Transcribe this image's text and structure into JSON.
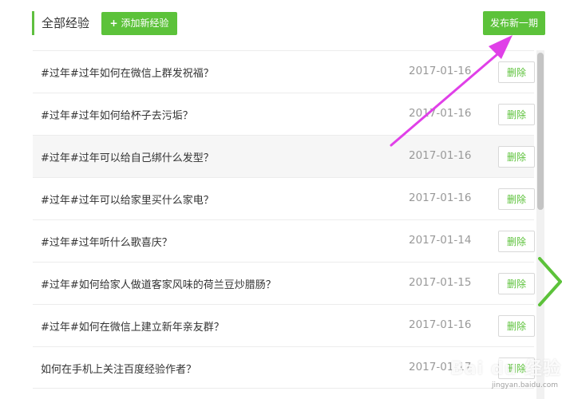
{
  "header": {
    "title": "全部经验",
    "add_button": "添加新经验",
    "add_icon": "+",
    "publish_button": "发布新一期"
  },
  "actions": {
    "delete_label": "删除"
  },
  "items": [
    {
      "name": "#过年#过年如何在微信上群发祝福？",
      "date": "2017-01-16"
    },
    {
      "name": "#过年#过年如何给杯子去污垢？",
      "date": "2017-01-16"
    },
    {
      "name": "#过年#过年可以给自己绑什么发型？",
      "date": "2017-01-16"
    },
    {
      "name": "#过年#过年可以给家里买什么家电？",
      "date": "2017-01-16"
    },
    {
      "name": "#过年#过年听什么歌喜庆？",
      "date": "2017-01-14"
    },
    {
      "name": "#过年#如何给家人做道客家风味的荷兰豆炒腊肠？",
      "date": "2017-01-15"
    },
    {
      "name": "#过年#如何在微信上建立新年亲友群？",
      "date": "2017-01-16"
    },
    {
      "name": "如何在手机上关注百度经验作者？",
      "date": "2017-01-17"
    }
  ],
  "watermark": {
    "text": "Bai du 经验",
    "sub": "jingyan.baidu.com"
  },
  "colors": {
    "accent": "#5cc23a",
    "arrow": "#e040e8"
  }
}
